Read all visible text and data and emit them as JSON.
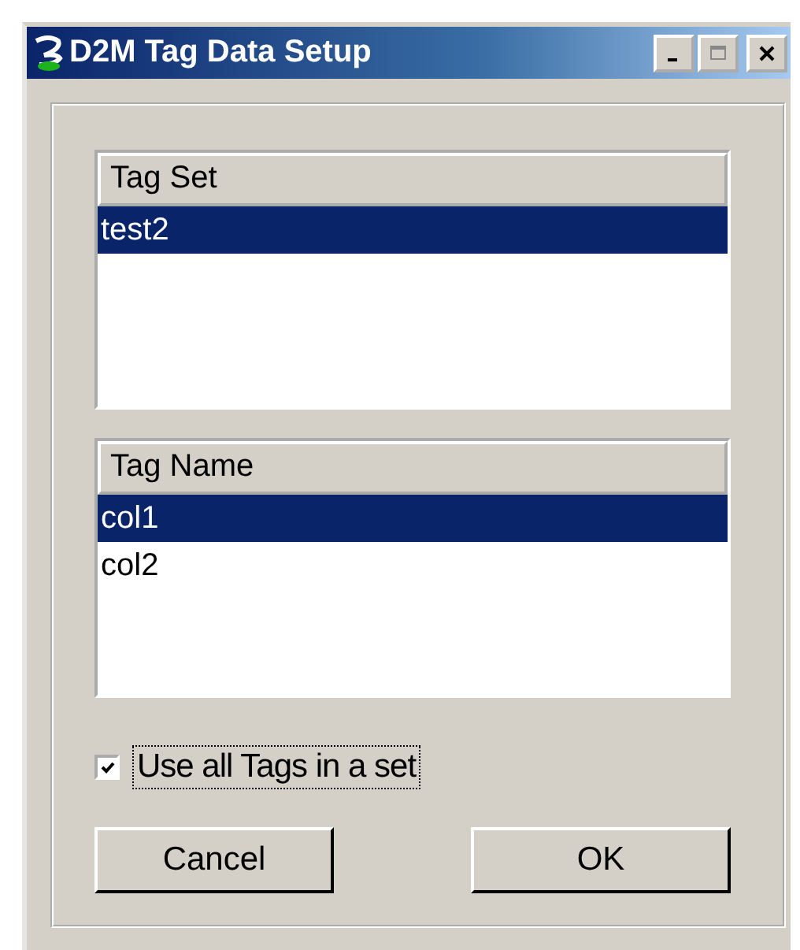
{
  "window": {
    "title": "D2M Tag Data Setup"
  },
  "lists": [
    {
      "header": "Tag Set",
      "items": [
        {
          "label": "test2",
          "selected": true
        }
      ]
    },
    {
      "header": "Tag Name",
      "items": [
        {
          "label": "col1",
          "selected": true
        },
        {
          "label": "col2",
          "selected": false
        }
      ]
    }
  ],
  "checkbox": {
    "label": "Use all Tags in a set",
    "checked": true
  },
  "buttons": [
    {
      "label": "Cancel",
      "kind": "cancel"
    },
    {
      "label": "OK",
      "kind": "ok"
    }
  ]
}
